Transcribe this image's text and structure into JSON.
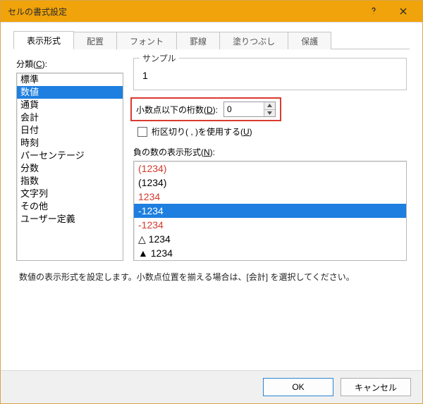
{
  "window": {
    "title": "セルの書式設定"
  },
  "tabs": [
    {
      "label": "表示形式",
      "active": true
    },
    {
      "label": "配置",
      "active": false
    },
    {
      "label": "フォント",
      "active": false
    },
    {
      "label": "罫線",
      "active": false
    },
    {
      "label": "塗りつぶし",
      "active": false
    },
    {
      "label": "保護",
      "active": false
    }
  ],
  "category": {
    "label_prefix": "分類(",
    "label_accel": "C",
    "label_suffix": "):",
    "items": [
      "標準",
      "数値",
      "通貨",
      "会計",
      "日付",
      "時刻",
      "パーセンテージ",
      "分数",
      "指数",
      "文字列",
      "その他",
      "ユーザー定義"
    ],
    "selected_index": 1
  },
  "sample": {
    "legend": "サンプル",
    "value": "1"
  },
  "decimal": {
    "label_prefix": "小数点以下の桁数(",
    "label_accel": "D",
    "label_suffix": "):",
    "value": "0"
  },
  "thousands": {
    "checked": false,
    "label_prefix": "桁区切り( , )を使用する(",
    "label_accel": "U",
    "label_suffix": ")"
  },
  "negative": {
    "label_prefix": "負の数の表示形式(",
    "label_accel": "N",
    "label_suffix": "):",
    "items": [
      {
        "text": "(1234)",
        "color": "#d23a2e"
      },
      {
        "text": "(1234)",
        "color": "#000000"
      },
      {
        "text": "1234",
        "color": "#d23a2e"
      },
      {
        "text": "-1234",
        "color": "#000000"
      },
      {
        "text": "-1234",
        "color": "#d23a2e"
      },
      {
        "text": "△ 1234",
        "color": "#000000"
      },
      {
        "text": "▲ 1234",
        "color": "#000000"
      }
    ],
    "selected_index": 3
  },
  "description": "数値の表示形式を設定します。小数点位置を揃える場合は、[会計] を選択してください。",
  "buttons": {
    "ok": "OK",
    "cancel": "キャンセル"
  }
}
